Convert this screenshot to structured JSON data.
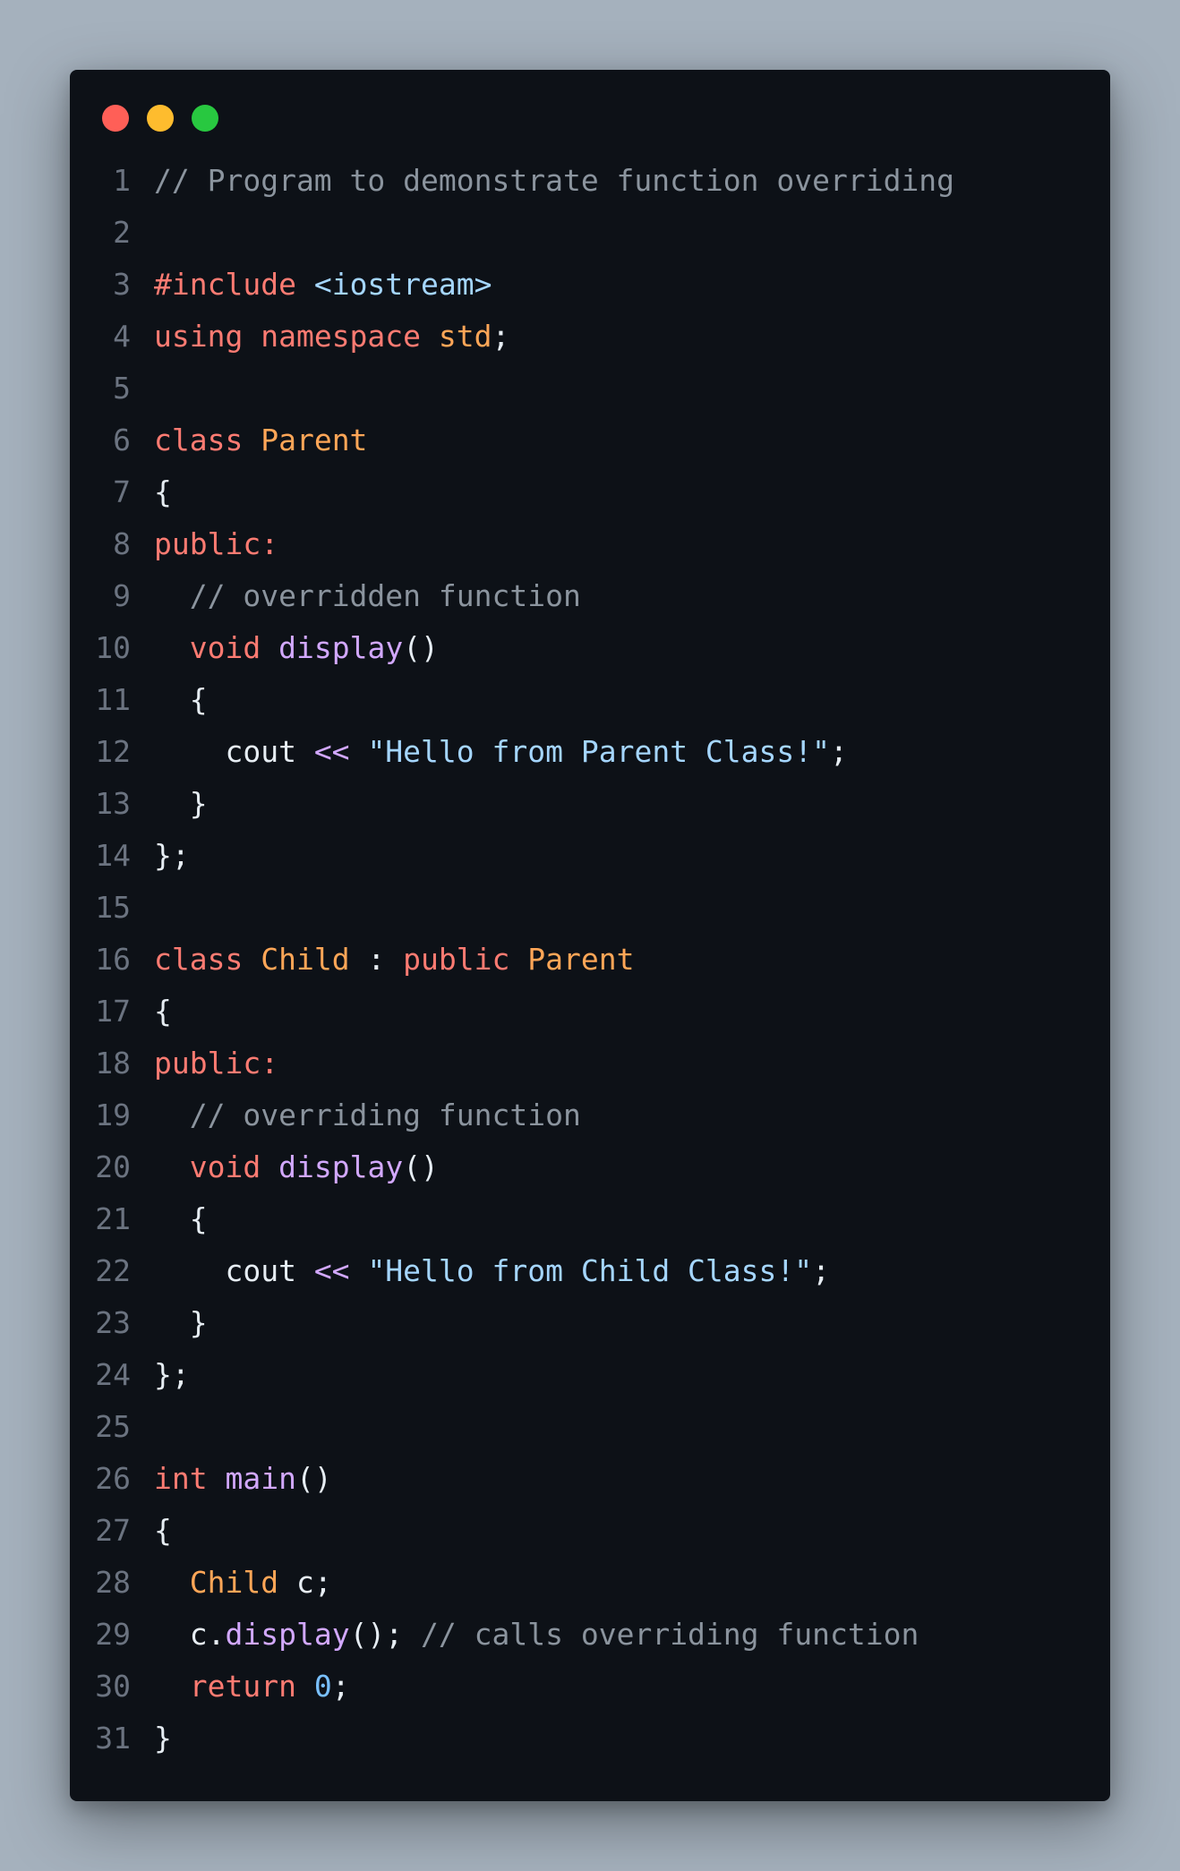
{
  "window": {
    "controls": [
      {
        "name": "close",
        "color": "#ff5f57"
      },
      {
        "name": "minimize",
        "color": "#febc2e"
      },
      {
        "name": "maximize",
        "color": "#28c840"
      }
    ]
  },
  "code": {
    "language": "cpp",
    "lines": [
      {
        "n": "1",
        "tokens": [
          {
            "t": "comment",
            "v": "// Program to demonstrate function overriding"
          }
        ]
      },
      {
        "n": "2",
        "tokens": []
      },
      {
        "n": "3",
        "tokens": [
          {
            "t": "keyword",
            "v": "#include"
          },
          {
            "t": "plain",
            "v": " "
          },
          {
            "t": "string",
            "v": "<iostream>"
          }
        ]
      },
      {
        "n": "4",
        "tokens": [
          {
            "t": "keyword",
            "v": "using"
          },
          {
            "t": "plain",
            "v": " "
          },
          {
            "t": "keyword",
            "v": "namespace"
          },
          {
            "t": "plain",
            "v": " "
          },
          {
            "t": "type",
            "v": "std"
          },
          {
            "t": "plain",
            "v": ";"
          }
        ]
      },
      {
        "n": "5",
        "tokens": []
      },
      {
        "n": "6",
        "tokens": [
          {
            "t": "keyword",
            "v": "class"
          },
          {
            "t": "plain",
            "v": " "
          },
          {
            "t": "type",
            "v": "Parent"
          }
        ]
      },
      {
        "n": "7",
        "tokens": [
          {
            "t": "plain",
            "v": "{"
          }
        ]
      },
      {
        "n": "8",
        "tokens": [
          {
            "t": "keyword",
            "v": "public:"
          }
        ]
      },
      {
        "n": "9",
        "tokens": [
          {
            "t": "plain",
            "v": "  "
          },
          {
            "t": "comment",
            "v": "// overridden function"
          }
        ]
      },
      {
        "n": "10",
        "tokens": [
          {
            "t": "plain",
            "v": "  "
          },
          {
            "t": "keyword",
            "v": "void"
          },
          {
            "t": "plain",
            "v": " "
          },
          {
            "t": "func",
            "v": "display"
          },
          {
            "t": "plain",
            "v": "()"
          }
        ]
      },
      {
        "n": "11",
        "tokens": [
          {
            "t": "plain",
            "v": "  {"
          }
        ]
      },
      {
        "n": "12",
        "tokens": [
          {
            "t": "plain",
            "v": "    cout "
          },
          {
            "t": "func",
            "v": "<<"
          },
          {
            "t": "plain",
            "v": " "
          },
          {
            "t": "string",
            "v": "\"Hello from Parent Class!\""
          },
          {
            "t": "plain",
            "v": ";"
          }
        ]
      },
      {
        "n": "13",
        "tokens": [
          {
            "t": "plain",
            "v": "  }"
          }
        ]
      },
      {
        "n": "14",
        "tokens": [
          {
            "t": "plain",
            "v": "};"
          }
        ]
      },
      {
        "n": "15",
        "tokens": []
      },
      {
        "n": "16",
        "tokens": [
          {
            "t": "keyword",
            "v": "class"
          },
          {
            "t": "plain",
            "v": " "
          },
          {
            "t": "type",
            "v": "Child"
          },
          {
            "t": "plain",
            "v": " : "
          },
          {
            "t": "keyword",
            "v": "public"
          },
          {
            "t": "plain",
            "v": " "
          },
          {
            "t": "type",
            "v": "Parent"
          }
        ]
      },
      {
        "n": "17",
        "tokens": [
          {
            "t": "plain",
            "v": "{"
          }
        ]
      },
      {
        "n": "18",
        "tokens": [
          {
            "t": "keyword",
            "v": "public:"
          }
        ]
      },
      {
        "n": "19",
        "tokens": [
          {
            "t": "plain",
            "v": "  "
          },
          {
            "t": "comment",
            "v": "// overriding function"
          }
        ]
      },
      {
        "n": "20",
        "tokens": [
          {
            "t": "plain",
            "v": "  "
          },
          {
            "t": "keyword",
            "v": "void"
          },
          {
            "t": "plain",
            "v": " "
          },
          {
            "t": "func",
            "v": "display"
          },
          {
            "t": "plain",
            "v": "()"
          }
        ]
      },
      {
        "n": "21",
        "tokens": [
          {
            "t": "plain",
            "v": "  {"
          }
        ]
      },
      {
        "n": "22",
        "tokens": [
          {
            "t": "plain",
            "v": "    cout "
          },
          {
            "t": "func",
            "v": "<<"
          },
          {
            "t": "plain",
            "v": " "
          },
          {
            "t": "string",
            "v": "\"Hello from Child Class!\""
          },
          {
            "t": "plain",
            "v": ";"
          }
        ]
      },
      {
        "n": "23",
        "tokens": [
          {
            "t": "plain",
            "v": "  }"
          }
        ]
      },
      {
        "n": "24",
        "tokens": [
          {
            "t": "plain",
            "v": "};"
          }
        ]
      },
      {
        "n": "25",
        "tokens": []
      },
      {
        "n": "26",
        "tokens": [
          {
            "t": "keyword",
            "v": "int"
          },
          {
            "t": "plain",
            "v": " "
          },
          {
            "t": "func",
            "v": "main"
          },
          {
            "t": "plain",
            "v": "()"
          }
        ]
      },
      {
        "n": "27",
        "tokens": [
          {
            "t": "plain",
            "v": "{"
          }
        ]
      },
      {
        "n": "28",
        "tokens": [
          {
            "t": "plain",
            "v": "  "
          },
          {
            "t": "type",
            "v": "Child"
          },
          {
            "t": "plain",
            "v": " c;"
          }
        ]
      },
      {
        "n": "29",
        "tokens": [
          {
            "t": "plain",
            "v": "  c."
          },
          {
            "t": "func",
            "v": "display"
          },
          {
            "t": "plain",
            "v": "(); "
          },
          {
            "t": "comment",
            "v": "// calls overriding function"
          }
        ]
      },
      {
        "n": "30",
        "tokens": [
          {
            "t": "plain",
            "v": "  "
          },
          {
            "t": "keyword",
            "v": "return"
          },
          {
            "t": "plain",
            "v": " "
          },
          {
            "t": "number",
            "v": "0"
          },
          {
            "t": "plain",
            "v": ";"
          }
        ]
      },
      {
        "n": "31",
        "tokens": [
          {
            "t": "plain",
            "v": "}"
          }
        ]
      }
    ]
  }
}
